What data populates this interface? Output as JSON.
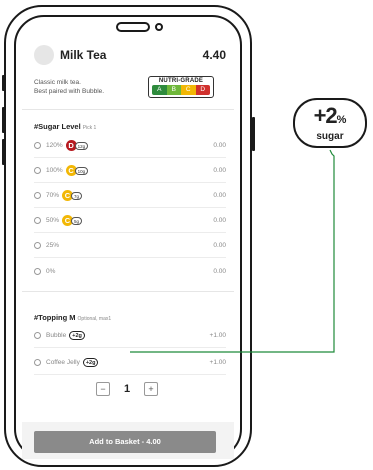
{
  "product": {
    "title": "Milk Tea",
    "price": "4.40",
    "desc_line1": "Classic milk tea.",
    "desc_line2": "Best paired with Bubble."
  },
  "nutrigrade": {
    "label": "NUTRI-GRADE",
    "grades": [
      "A",
      "B",
      "C",
      "D"
    ]
  },
  "sugar": {
    "title": "#Sugar Level",
    "subtitle": "Pick 1",
    "options": [
      {
        "label": "120%",
        "price": "0.00",
        "grade": "D",
        "grams": "12g"
      },
      {
        "label": "100%",
        "price": "0.00",
        "grade": "C",
        "grams": "10g"
      },
      {
        "label": "70%",
        "price": "0.00",
        "grade": "C",
        "grams": "7g"
      },
      {
        "label": "50%",
        "price": "0.00",
        "grade": "C",
        "grams": "5g"
      },
      {
        "label": "25%",
        "price": "0.00"
      },
      {
        "label": "0%",
        "price": "0.00"
      }
    ]
  },
  "topping": {
    "title": "#Topping M",
    "subtitle": "Optional, max1",
    "options": [
      {
        "label": "Bubble",
        "badge": "+2g",
        "price": "+1.00"
      },
      {
        "label": "Coffee Jelly",
        "badge": "+2g",
        "price": "+1.00"
      }
    ]
  },
  "quantity": {
    "minus": "−",
    "value": "1",
    "plus": "+"
  },
  "basket": {
    "label": "Add to Basket - 4.00"
  },
  "callout": {
    "value": "+2",
    "unit": "%",
    "label": "sugar"
  },
  "colors": {
    "grade_a": "#2e8b3d",
    "grade_b": "#6fb83a",
    "grade_c": "#f2b705",
    "grade_d": "#d0312d",
    "connector": "#1f8a3a"
  }
}
